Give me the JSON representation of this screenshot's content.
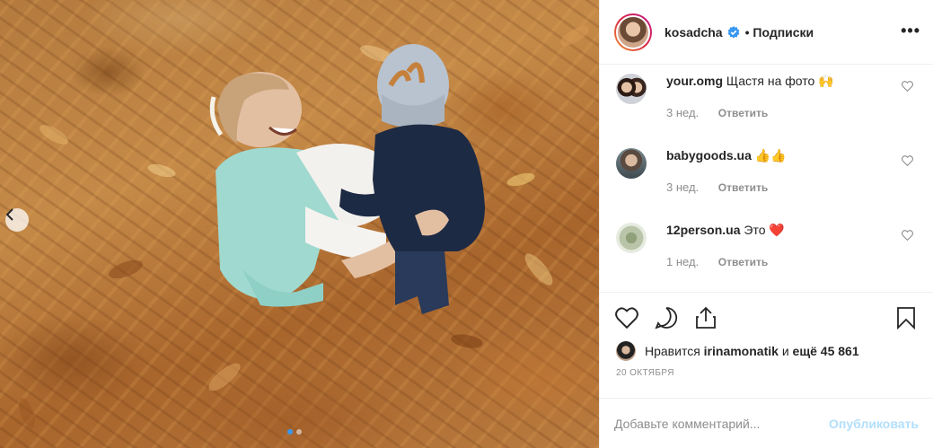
{
  "header": {
    "username": "kosadcha",
    "follow_label": "• Подписки",
    "more_icon": "more-dots-icon"
  },
  "comments": [
    {
      "username": "your.omg",
      "text": "Щастя на фото 🙌",
      "time": "3 нед.",
      "reply": "Ответить"
    },
    {
      "username": "babygoods.ua",
      "text": "👍👍",
      "time": "3 нед.",
      "reply": "Ответить"
    },
    {
      "username": "12person.ua",
      "text": "Это ❤️",
      "time": "1 нед.",
      "reply": "Ответить"
    }
  ],
  "likes": {
    "prefix": "Нравится ",
    "user": "irinamonatik",
    "middle": " и ",
    "count": "ещё 45 861"
  },
  "date": "20 ОКТЯБРЯ",
  "comment_box": {
    "placeholder": "Добавьте комментарий...",
    "publish": "Опубликовать"
  },
  "colors": {
    "verified": "#3897f0",
    "publish_disabled": "#b2dffc",
    "heart": "#ed4956"
  }
}
